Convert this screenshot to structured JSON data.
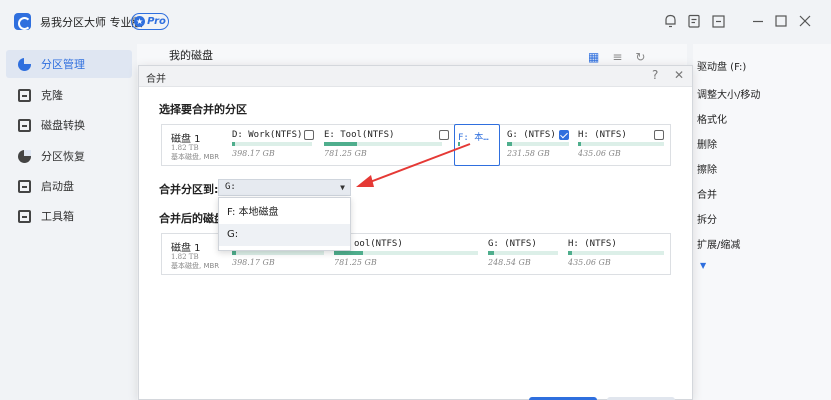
{
  "app": {
    "title": "易我分区大师 专业版",
    "badge": "Pro"
  },
  "window_controls": [
    "bell-icon",
    "clipboard-icon",
    "dialog-icon",
    "minimize",
    "maximize",
    "close"
  ],
  "sidebar": {
    "items": [
      {
        "label": "分区管理",
        "active": true
      },
      {
        "label": "克隆"
      },
      {
        "label": "磁盘转换"
      },
      {
        "label": "分区恢复"
      },
      {
        "label": "启动盘"
      },
      {
        "label": "工具箱"
      }
    ]
  },
  "main": {
    "heading": "我的磁盘"
  },
  "operations": {
    "items": [
      "驱动盘 (F:)",
      "调整大小/移动",
      "格式化",
      "删除",
      "擦除",
      "合并",
      "拆分",
      "扩展/缩减"
    ]
  },
  "dialog": {
    "title": "合并",
    "select_title": "选择要合并的分区",
    "merge_to_label": "合并分区到:",
    "merge_to_value": "G:",
    "result_title": "合并后的磁盘",
    "disk": {
      "name": "磁盘 1",
      "size": "1.82 TB",
      "type": "基本磁盘, MBR"
    },
    "partitions": [
      {
        "name": "D: Work(NTFS)",
        "size": "398.17 GB",
        "fill": 0.04,
        "checked": false
      },
      {
        "name": "E: Tool(NTFS)",
        "size": "781.25 GB",
        "fill": 0.28,
        "checked": false
      },
      {
        "name": "F: 本…",
        "size": "",
        "fill": 0.0,
        "checked": false,
        "selected": true
      },
      {
        "name": "G: (NTFS)",
        "size": "231.58 GB",
        "fill": 0.08,
        "checked": true
      },
      {
        "name": "H: (NTFS)",
        "size": "435.06 GB",
        "fill": 0.04,
        "checked": false
      }
    ],
    "result_partitions": [
      {
        "name": "",
        "size": "398.17 GB",
        "fill": 0.04
      },
      {
        "name": "ool(NTFS)",
        "size": "781.25 GB",
        "fill": 0.2
      },
      {
        "name": "G: (NTFS)",
        "size": "248.54 GB",
        "fill": 0.08
      },
      {
        "name": "H: (NTFS)",
        "size": "435.06 GB",
        "fill": 0.04
      }
    ],
    "dropdown_options": [
      "F: 本地磁盘",
      "G:"
    ]
  }
}
